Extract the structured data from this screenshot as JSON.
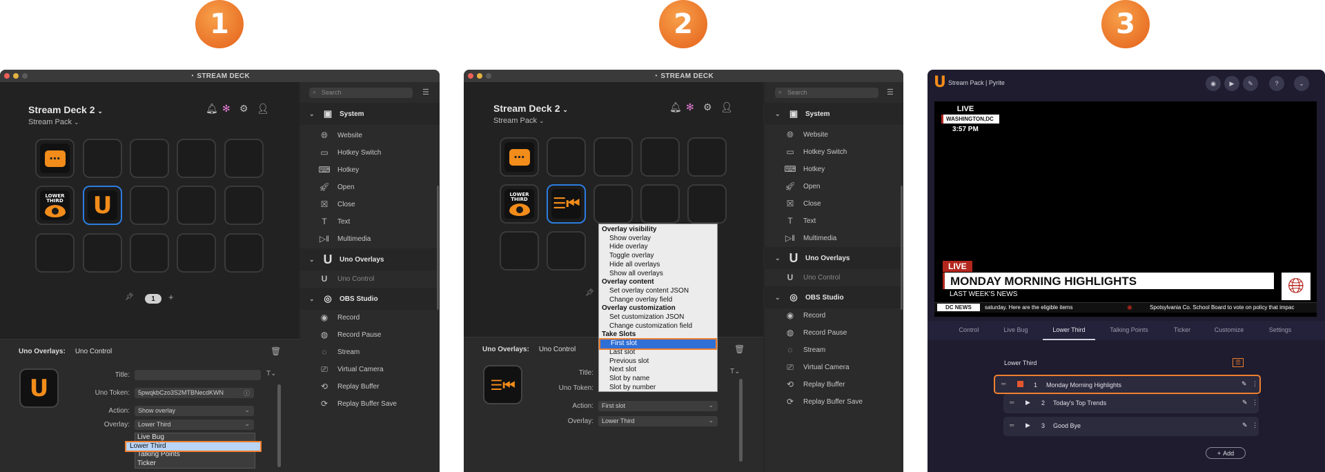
{
  "steps": [
    "1",
    "2",
    "3"
  ],
  "streamdeck": {
    "window_title": "STREAM DECK",
    "device_name": "Stream Deck 2",
    "profile": "Stream Pack",
    "page_number": "1",
    "key_lower_third_label": "LOWER THIRD",
    "search_placeholder": "Search",
    "categories": {
      "system": "System",
      "uno": "Uno Overlays",
      "obs": "OBS Studio"
    },
    "system_items": [
      "Website",
      "Hotkey Switch",
      "Hotkey",
      "Open",
      "Close",
      "Text",
      "Multimedia"
    ],
    "uno_items": [
      "Uno Control"
    ],
    "obs_items": [
      "Record",
      "Record Pause",
      "Stream",
      "Virtual Camera",
      "Replay Buffer",
      "Replay Buffer Save"
    ],
    "inspector": {
      "plugin": "Uno Overlays:",
      "action_name": "Uno Control",
      "title_label": "Title:",
      "token_label": "Uno Token:",
      "token_value": "5pwqkbCzo3S2MTBNecdKWN",
      "action_label": "Action:",
      "overlay_label": "Overlay:"
    },
    "panel1": {
      "action_value": "Show overlay",
      "overlay_value": "Lower Third",
      "overlay_options": [
        "Live Bug",
        "Lower Third",
        "Talking Points",
        "Ticker"
      ]
    },
    "panel2": {
      "action_value": "First slot",
      "overlay_value": "Lower Third",
      "menu": [
        {
          "text": "Overlay visibility",
          "header": true
        },
        {
          "text": "Show overlay"
        },
        {
          "text": "Hide overlay"
        },
        {
          "text": "Toggle overlay"
        },
        {
          "text": "Hide all overlays"
        },
        {
          "text": "Show all overlays"
        },
        {
          "text": "Overlay content",
          "header": true
        },
        {
          "text": "Set overlay content JSON"
        },
        {
          "text": "Change overlay field"
        },
        {
          "text": "Overlay customization",
          "header": true
        },
        {
          "text": "Set customization JSON"
        },
        {
          "text": "Change customization field"
        },
        {
          "text": "Take Slots",
          "header": true
        },
        {
          "text": "First slot",
          "selected": true
        },
        {
          "text": "Last slot"
        },
        {
          "text": "Previous slot"
        },
        {
          "text": "Next slot"
        },
        {
          "text": "Slot by name"
        },
        {
          "text": "Slot by number"
        }
      ]
    }
  },
  "pyrite": {
    "title": "Stream Pack | Pyrite",
    "bug_live": "LIVE",
    "bug_location": "WASHINGTON,DC",
    "bug_time": "3:57 PM",
    "lt_tag": "LIVE",
    "lt_headline": "MONDAY MORNING HIGHLIGHTS",
    "lt_sub": "LAST WEEK'S NEWS",
    "ticker_label": "DC NEWS",
    "ticker_text1": "saturday. Here are the eligible items",
    "ticker_text2": "Spotsylvania Co. School Board to vote on policy that impac",
    "tabs": [
      "Control",
      "Live Bug",
      "Lower Third",
      "Talking Points",
      "Ticker",
      "Customize",
      "Settings"
    ],
    "active_tab": "Lower Third",
    "section_title": "Lower Third",
    "rows": [
      {
        "num": "1",
        "title": "Monday Morning Highlights"
      },
      {
        "num": "2",
        "title": "Today's Top Trends"
      },
      {
        "num": "3",
        "title": "Good Bye"
      }
    ],
    "add_label": "Add"
  },
  "colors": {
    "accent_orange": "#f28c1a",
    "selection_blue": "#2d7de0",
    "highlight_outline": "#f08030",
    "lower_third_red": "#b3261e"
  }
}
